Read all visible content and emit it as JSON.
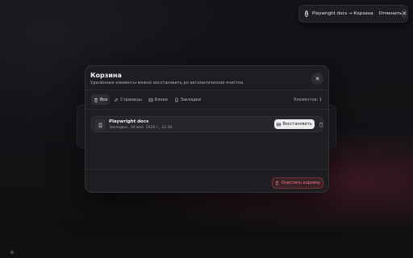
{
  "toast": {
    "message": "Playwright docs → Корзина",
    "undo_label": "Отменить",
    "close_glyph": "✕"
  },
  "dialog": {
    "title": "Корзина",
    "subtitle": "Удалённые элементы можно восстановить до автоматической очистки.",
    "close_glyph": "✕",
    "tabs": [
      {
        "label": "Все",
        "icon": "trash-icon",
        "active": true
      },
      {
        "label": "Страницы",
        "icon": "link-icon",
        "active": false
      },
      {
        "label": "Блоки",
        "icon": "grid-icon",
        "active": false
      },
      {
        "label": "Закладки",
        "icon": "bookmark-icon",
        "active": false
      }
    ],
    "count_label": "Элементов:",
    "count_value": "1",
    "items": [
      {
        "title": "Playwright docs",
        "meta": "Закладка · 26 мая. 2026 г., 22:39",
        "icon": "bookmark-icon",
        "restore_label": "Восстановить"
      }
    ],
    "empty_label": "Очистить корзину"
  },
  "colors": {
    "accent_danger": "#f07a82",
    "restore_bg": "#ececef"
  }
}
